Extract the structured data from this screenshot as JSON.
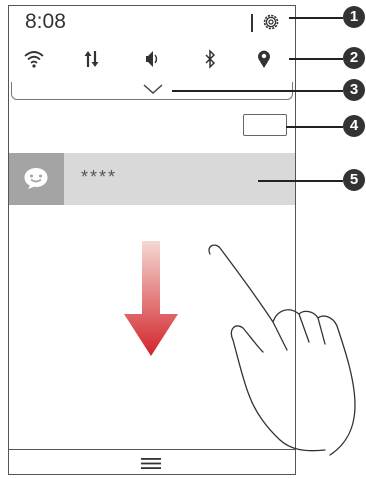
{
  "status_bar": {
    "time": "8:08",
    "settings_icon": "gear-icon"
  },
  "quick_toggles": [
    {
      "name": "wifi",
      "icon": "wifi-icon"
    },
    {
      "name": "mobile-data",
      "icon": "data-transfer-icon"
    },
    {
      "name": "sound",
      "icon": "volume-icon"
    },
    {
      "name": "bluetooth",
      "icon": "bluetooth-icon"
    },
    {
      "name": "location",
      "icon": "location-icon"
    }
  ],
  "notification": {
    "app_icon": "message-bubble-icon",
    "text": "****"
  },
  "callouts": [
    "1",
    "2",
    "3",
    "4",
    "5"
  ],
  "colors": {
    "arrow_top": "#f5d9d3",
    "arrow_bottom": "#d2232a",
    "notification_bg": "#d9d9d9",
    "notification_icon_bg": "#a4a4a4"
  }
}
